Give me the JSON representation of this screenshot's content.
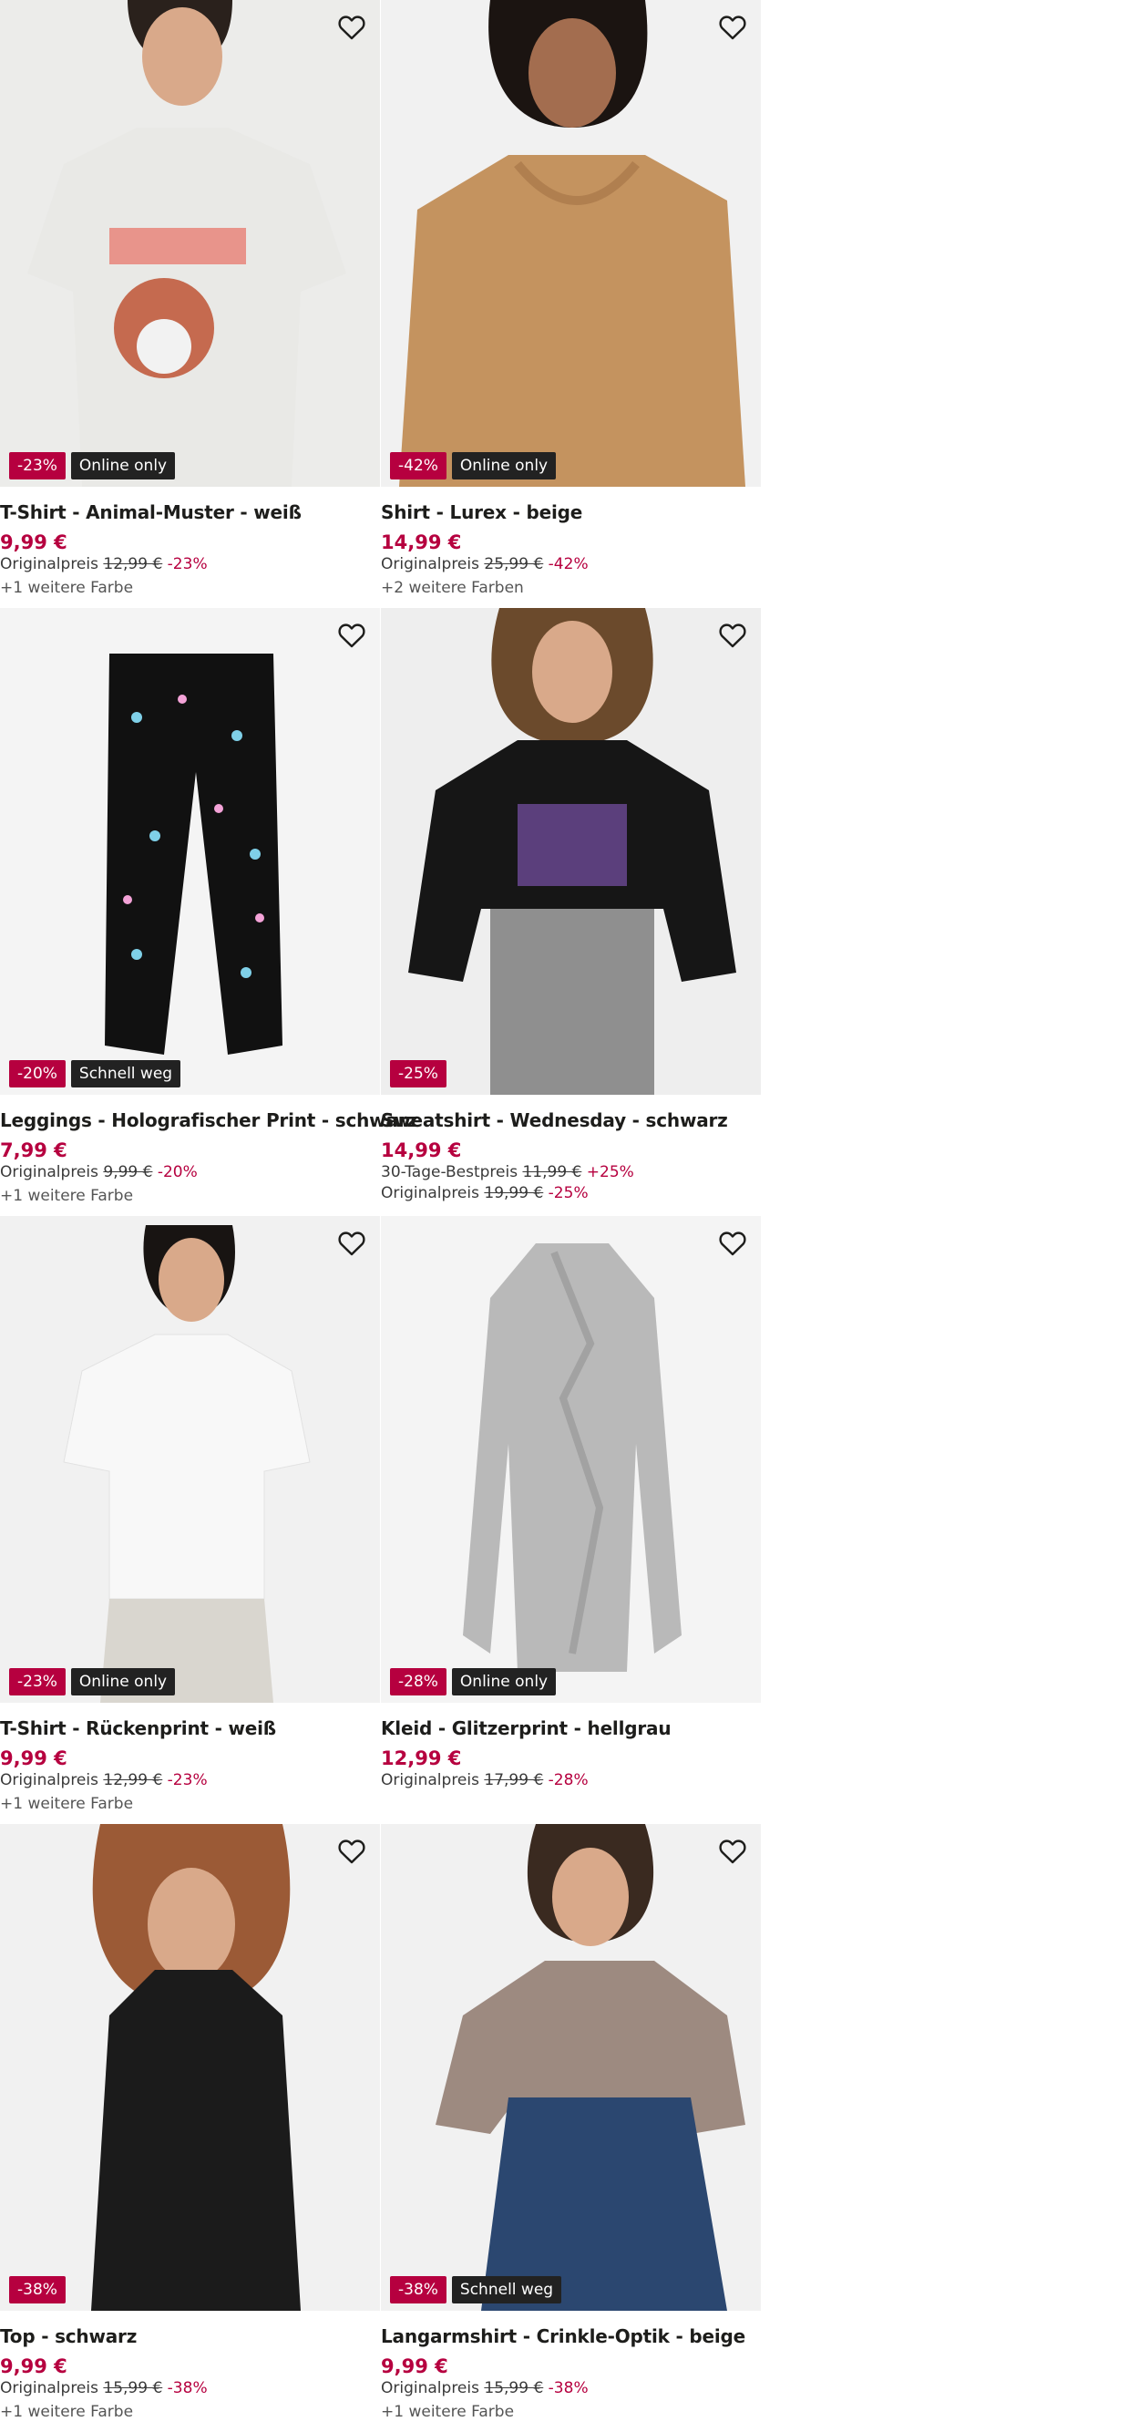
{
  "products": [
    {
      "name": "T-Shirt - Animal-Muster - weiß",
      "price": "9,99 €",
      "badges": [
        {
          "text": "-23%",
          "kind": "discount"
        },
        {
          "text": "Online only",
          "kind": "info"
        }
      ],
      "lines": [
        {
          "label": "Originalpreis",
          "old": "12,99 €",
          "pct": "-23%"
        }
      ],
      "more": "+1 weitere Farbe",
      "image": {
        "bg": "#ececea",
        "garment": "#e9e9e6",
        "accent": "#e7857a",
        "type": "tshirt-print"
      }
    },
    {
      "name": "Shirt - Lurex - beige",
      "price": "14,99 €",
      "badges": [
        {
          "text": "-42%",
          "kind": "discount"
        },
        {
          "text": "Online only",
          "kind": "info"
        }
      ],
      "lines": [
        {
          "label": "Originalpreis",
          "old": "25,99 €",
          "pct": "-42%"
        }
      ],
      "more": "+2 weitere Farben",
      "image": {
        "bg": "#f1f1f1",
        "garment": "#c4935f",
        "accent": "#b07f4f",
        "type": "longsleeve"
      }
    },
    {
      "name": "Leggings - Holografischer Print - schwarz",
      "price": "7,99 €",
      "badges": [
        {
          "text": "-20%",
          "kind": "discount"
        },
        {
          "text": "Schnell weg",
          "kind": "info"
        }
      ],
      "lines": [
        {
          "label": "Originalpreis",
          "old": "9,99 €",
          "pct": "-20%"
        }
      ],
      "more": "+1 weitere Farbe",
      "image": {
        "bg": "#f4f4f4",
        "garment": "#111111",
        "accent": "#7fd0e8",
        "type": "leggings"
      }
    },
    {
      "name": "Sweatshirt - Wednesday - schwarz",
      "price": "14,99 €",
      "badges": [
        {
          "text": "-25%",
          "kind": "discount"
        }
      ],
      "lines": [
        {
          "label": "30-Tage-Bestpreis",
          "old": "11,99 €",
          "pct": "+25%"
        },
        {
          "label": "Originalpreis",
          "old": "19,99 €",
          "pct": "-25%"
        }
      ],
      "more": "",
      "image": {
        "bg": "#eeeeee",
        "garment": "#161616",
        "accent": "#8a5cc2",
        "type": "sweatshirt"
      }
    },
    {
      "name": "T-Shirt - Rückenprint - weiß",
      "price": "9,99 €",
      "badges": [
        {
          "text": "-23%",
          "kind": "discount"
        },
        {
          "text": "Online only",
          "kind": "info"
        }
      ],
      "lines": [
        {
          "label": "Originalpreis",
          "old": "12,99 €",
          "pct": "-23%"
        }
      ],
      "more": "+1 weitere Farbe",
      "image": {
        "bg": "#f1f1f1",
        "garment": "#f8f8f8",
        "accent": "#d9d6cf",
        "type": "tshirt"
      }
    },
    {
      "name": "Kleid - Glitzerprint - hellgrau",
      "price": "12,99 €",
      "badges": [
        {
          "text": "-28%",
          "kind": "discount"
        },
        {
          "text": "Online only",
          "kind": "info"
        }
      ],
      "lines": [
        {
          "label": "Originalpreis",
          "old": "17,99 €",
          "pct": "-28%"
        }
      ],
      "more": "",
      "image": {
        "bg": "#f4f4f4",
        "garment": "#b9b9b9",
        "accent": "#a2a2a2",
        "type": "dress"
      }
    },
    {
      "name": "Top - schwarz",
      "price": "9,99 €",
      "badges": [
        {
          "text": "-38%",
          "kind": "discount"
        }
      ],
      "lines": [
        {
          "label": "Originalpreis",
          "old": "15,99 €",
          "pct": "-38%"
        }
      ],
      "more": "+1 weitere Farbe",
      "image": {
        "bg": "#f1f1f1",
        "garment": "#1b1b1b",
        "accent": "#9b5a36",
        "type": "top"
      }
    },
    {
      "name": "Langarmshirt - Crinkle-Optik - beige",
      "price": "9,99 €",
      "badges": [
        {
          "text": "-38%",
          "kind": "discount"
        },
        {
          "text": "Schnell weg",
          "kind": "info"
        }
      ],
      "lines": [
        {
          "label": "Originalpreis",
          "old": "15,99 €",
          "pct": "-38%"
        }
      ],
      "more": "+1 weitere Farbe",
      "image": {
        "bg": "#f1f1f1",
        "garment": "#9d8a80",
        "accent": "#2b4770",
        "type": "blouse"
      }
    }
  ],
  "colors": {
    "sale": "#b6003f",
    "badge_info": "#222222",
    "text": "#1d1d1b"
  },
  "icons": {
    "wishlist": "heart-outline-icon"
  }
}
